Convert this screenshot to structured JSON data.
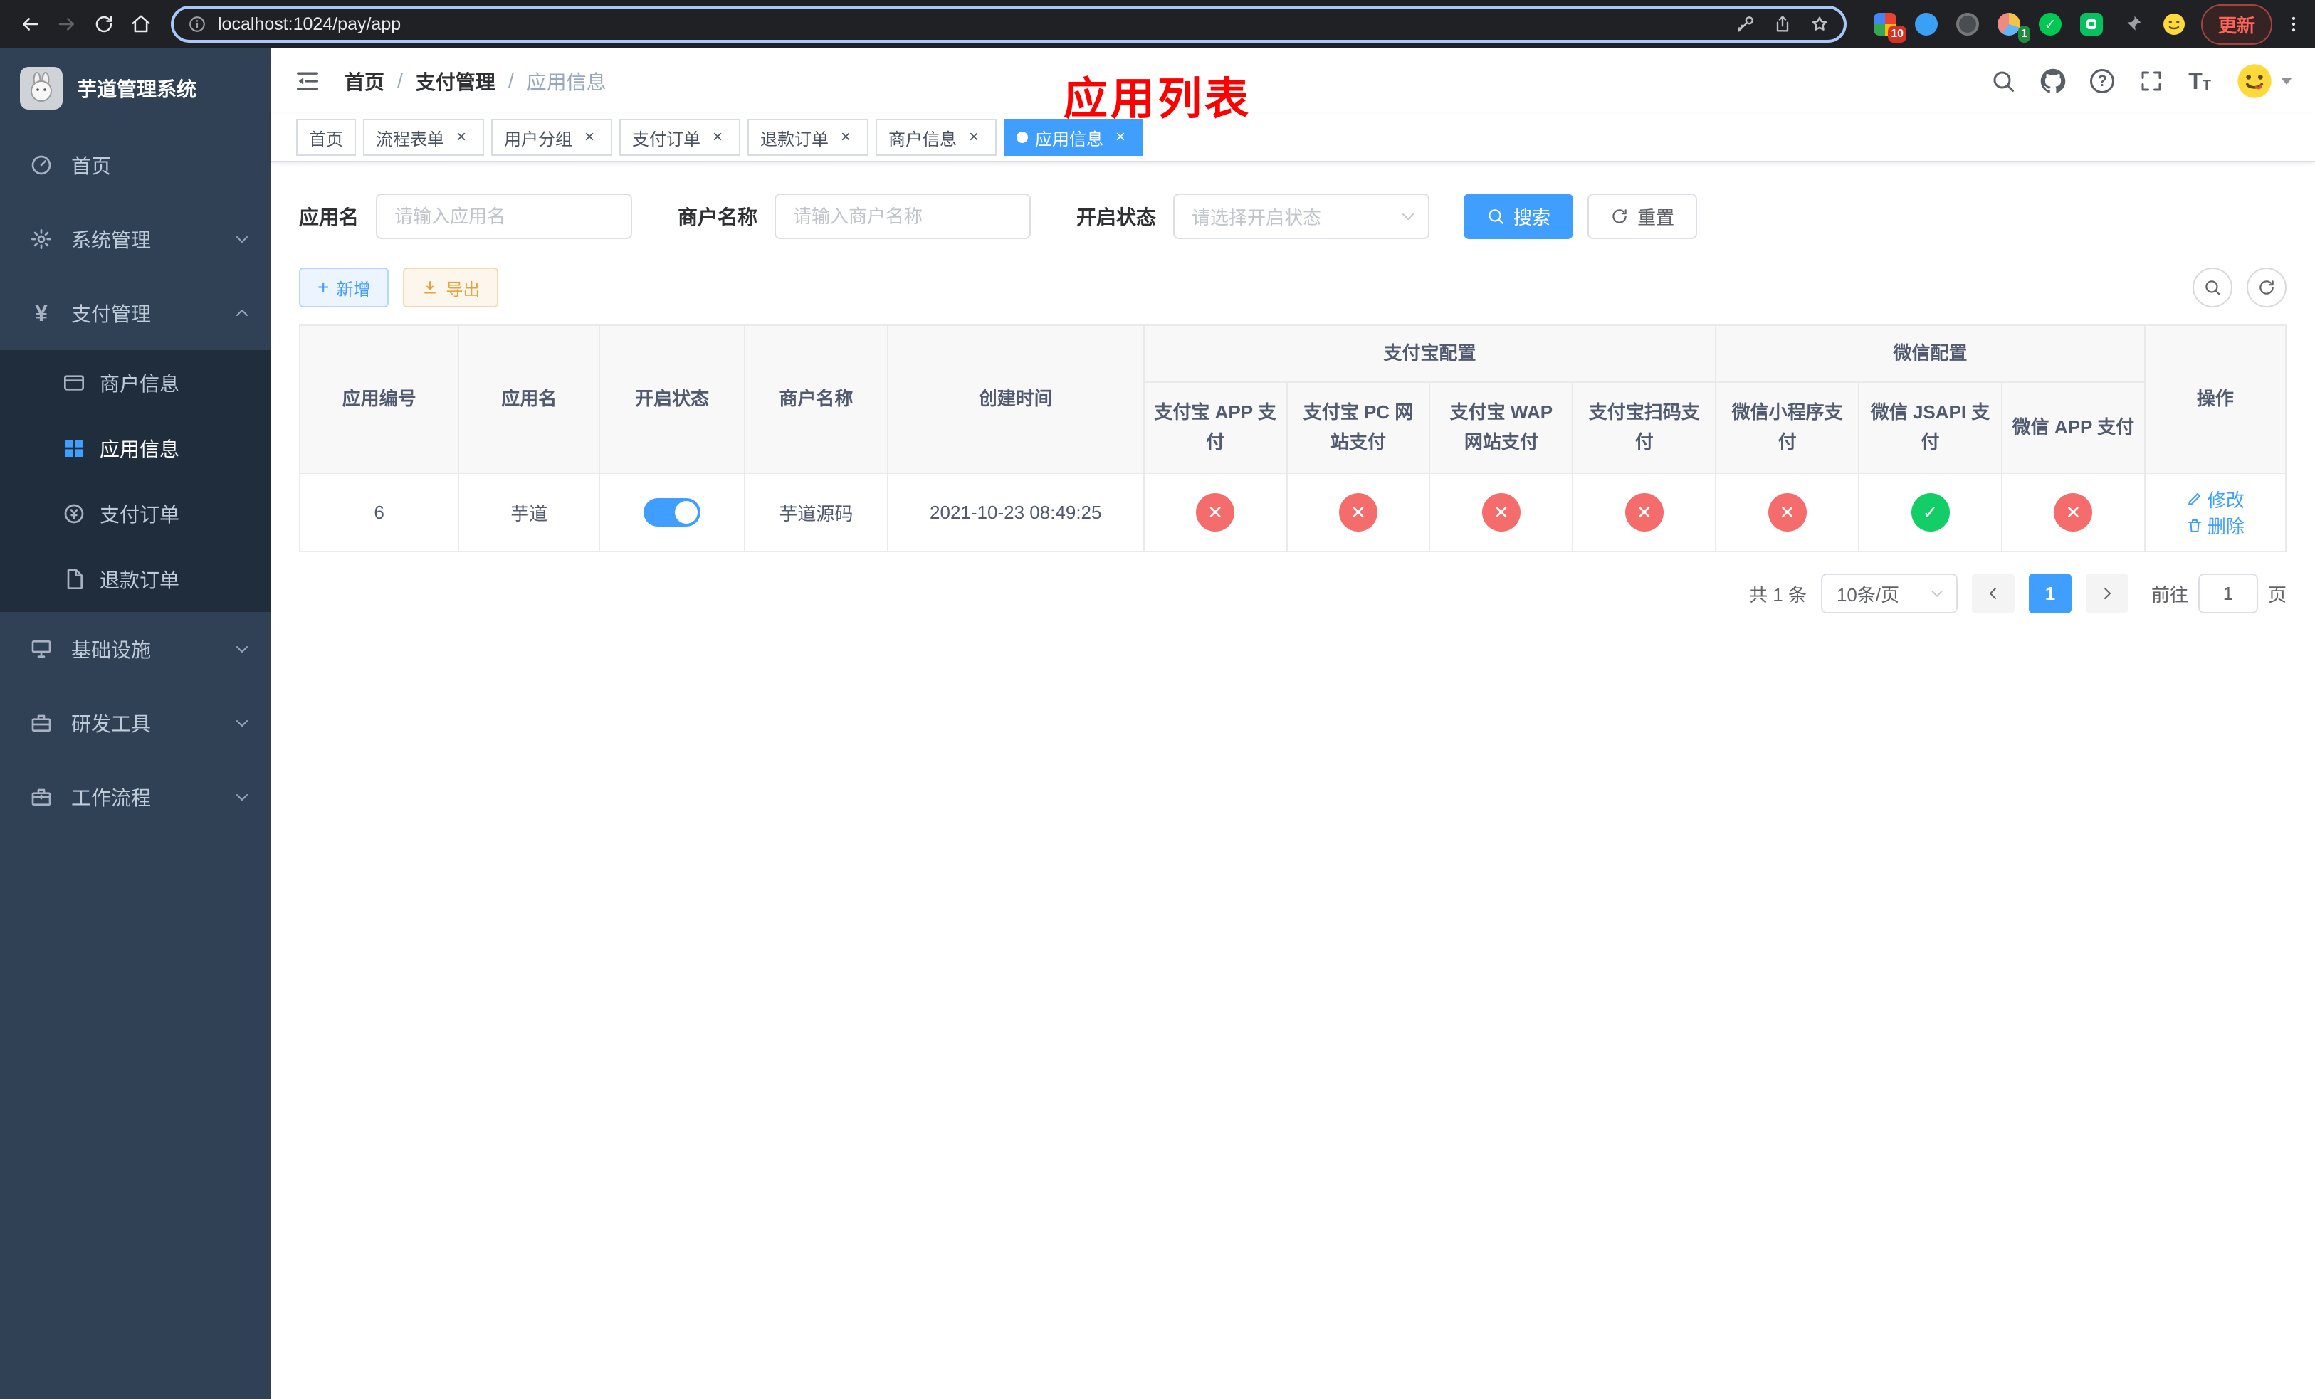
{
  "browser": {
    "url": "localhost:1024/pay/app",
    "update_label": "更新",
    "ext_badge_red": "10",
    "ext_badge_green": "1"
  },
  "sidebar": {
    "title": "芋道管理系统",
    "items": [
      {
        "label": "首页"
      },
      {
        "label": "系统管理"
      },
      {
        "label": "支付管理",
        "expanded": true,
        "children": [
          {
            "label": "商户信息"
          },
          {
            "label": "应用信息",
            "active": true
          },
          {
            "label": "支付订单"
          },
          {
            "label": "退款订单"
          }
        ]
      },
      {
        "label": "基础设施"
      },
      {
        "label": "研发工具"
      },
      {
        "label": "工作流程"
      }
    ]
  },
  "header": {
    "breadcrumb": [
      "首页",
      "支付管理",
      "应用信息"
    ],
    "page_title": "应用列表"
  },
  "tabs": [
    {
      "label": "首页",
      "closable": false
    },
    {
      "label": "流程表单",
      "closable": true
    },
    {
      "label": "用户分组",
      "closable": true
    },
    {
      "label": "支付订单",
      "closable": true
    },
    {
      "label": "退款订单",
      "closable": true
    },
    {
      "label": "商户信息",
      "closable": true
    },
    {
      "label": "应用信息",
      "closable": true,
      "active": true
    }
  ],
  "filters": {
    "app_name_label": "应用名",
    "app_name_placeholder": "请输入应用名",
    "merchant_label": "商户名称",
    "merchant_placeholder": "请输入商户名称",
    "status_label": "开启状态",
    "status_placeholder": "请选择开启状态",
    "search_label": "搜索",
    "reset_label": "重置"
  },
  "toolbar": {
    "add_label": "新增",
    "export_label": "导出"
  },
  "table": {
    "groups": {
      "alipay": "支付宝配置",
      "wechat": "微信配置"
    },
    "columns": {
      "app_id": "应用编号",
      "app_name": "应用名",
      "status": "开启状态",
      "merchant": "商户名称",
      "created": "创建时间",
      "alipay_app": "支付宝 APP 支付",
      "alipay_pc": "支付宝 PC 网站支付",
      "alipay_wap": "支付宝 WAP 网站支付",
      "alipay_qr": "支付宝扫码支付",
      "wx_mini": "微信小程序支付",
      "wx_jsapi": "微信 JSAPI 支付",
      "wx_app": "微信 APP 支付",
      "actions": "操作"
    },
    "rows": [
      {
        "app_id": "6",
        "app_name": "芋道",
        "enabled": true,
        "merchant": "芋道源码",
        "created": "2021-10-23 08:49:25",
        "configs": {
          "alipay_app": "no",
          "alipay_pc": "no",
          "alipay_wap": "no",
          "alipay_qr": "no",
          "wx_mini": "no",
          "wx_jsapi": "yes",
          "wx_app": "no"
        },
        "edit_label": "修改",
        "delete_label": "删除"
      }
    ]
  },
  "pagination": {
    "total": "共 1 条",
    "page_size": "10条/页",
    "current_page": "1",
    "goto_prefix": "前往",
    "goto_value": "1",
    "goto_suffix": "页"
  },
  "colors": {
    "primary": "#409EFF",
    "success": "#13ce66",
    "danger": "#f56c6c",
    "warning": "#e6a23c",
    "title_red": "#ff0000",
    "sidebar_bg": "#304156",
    "submenu_bg": "#1f2d3d"
  }
}
